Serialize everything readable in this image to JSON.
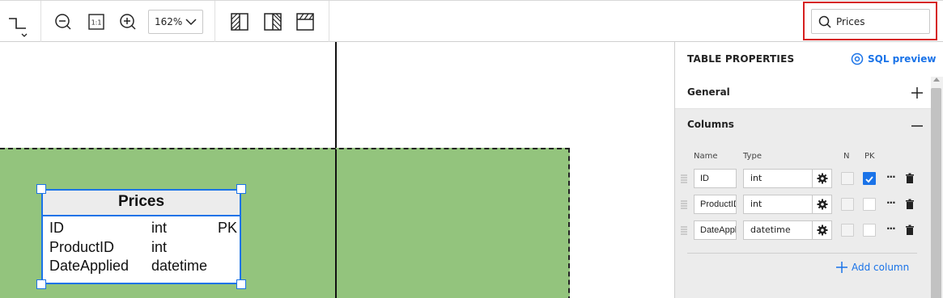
{
  "toolbar": {
    "zoom_value": "162%",
    "search_value": "Prices",
    "search_placeholder": "Search"
  },
  "diagram": {
    "table": {
      "title": "Prices",
      "rows": [
        {
          "name": "ID",
          "type": "int",
          "key": "PK"
        },
        {
          "name": "ProductID",
          "type": "int",
          "key": ""
        },
        {
          "name": "DateApplied",
          "type": "datetime",
          "key": ""
        }
      ]
    }
  },
  "panel": {
    "title": "TABLE PROPERTIES",
    "sql_preview_label": "SQL preview",
    "general_label": "General",
    "columns_label": "Columns",
    "col_headers": {
      "name": "Name",
      "type": "Type",
      "nullable": "N",
      "pk": "PK"
    },
    "columns": [
      {
        "name": "ID",
        "type": "int",
        "nullable": false,
        "pk": true
      },
      {
        "name": "ProductID",
        "type": "int",
        "nullable": false,
        "pk": false
      },
      {
        "name": "DateApplied",
        "type": "datetime",
        "nullable": false,
        "pk": false
      }
    ],
    "add_column_label": "Add column"
  },
  "colors": {
    "accent": "#1a73e8",
    "container_fill": "#93c47d",
    "highlight": "#d62020"
  }
}
